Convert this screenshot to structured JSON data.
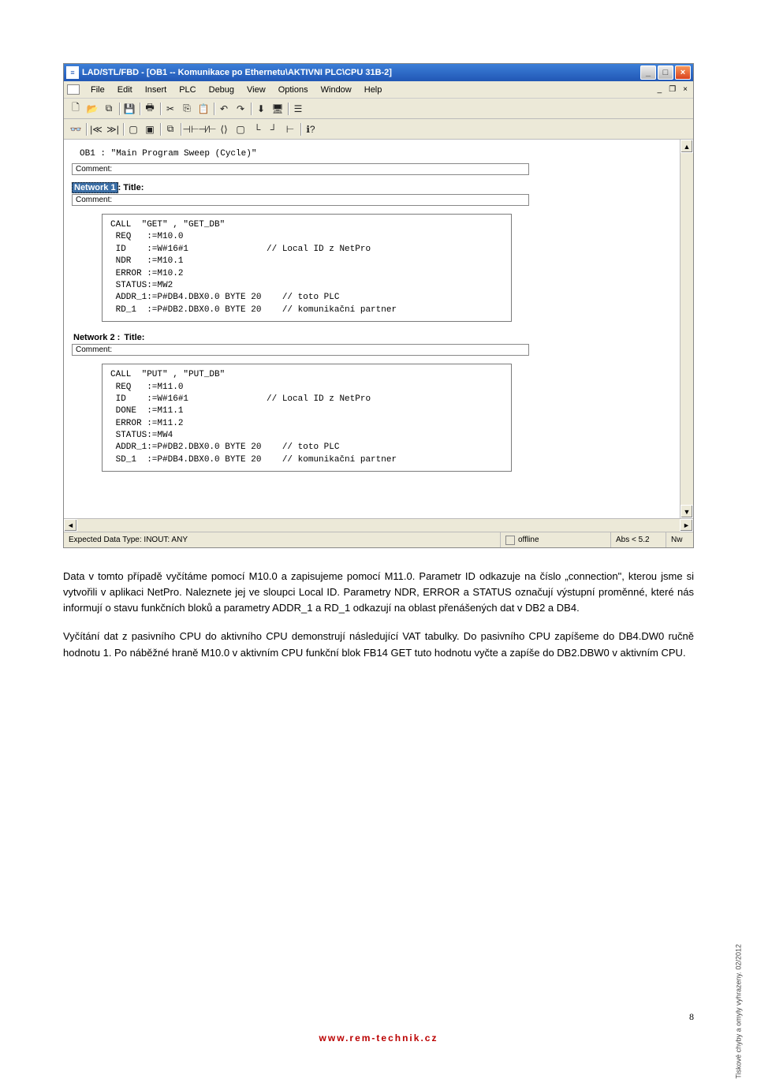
{
  "window": {
    "title": "LAD/STL/FBD  - [OB1 -- Komunikace po Ethernetu\\AKTIVNI PLC\\CPU 31B-2]",
    "minimize": "_",
    "maximize": "□",
    "close": "×"
  },
  "menu": {
    "items": [
      "File",
      "Edit",
      "Insert",
      "PLC",
      "Debug",
      "View",
      "Options",
      "Window",
      "Help"
    ],
    "mdi_minimize": "_",
    "mdi_restore": "❐",
    "mdi_close": "×"
  },
  "editor": {
    "header": "OB1 :  \"Main Program Sweep (Cycle)\"",
    "comment_label": "Comment:",
    "network1_label": "Network 1",
    "network1_title": ": Title:",
    "network2_label": "Network 2 :",
    "network2_title": " Title:",
    "code1": "CALL  \"GET\" , \"GET_DB\"\n REQ   :=M10.0\n ID    :=W#16#1               // Local ID z NetPro\n NDR   :=M10.1\n ERROR :=M10.2\n STATUS:=MW2\n ADDR_1:=P#DB4.DBX0.0 BYTE 20    // toto PLC\n RD_1  :=P#DB2.DBX0.0 BYTE 20    // komunikační partner",
    "code2": "CALL  \"PUT\" , \"PUT_DB\"\n REQ   :=M11.0\n ID    :=W#16#1               // Local ID z NetPro\n DONE  :=M11.1\n ERROR :=M11.2\n STATUS:=MW4\n ADDR_1:=P#DB2.DBX0.0 BYTE 20    // toto PLC\n SD_1  :=P#DB4.DBX0.0 BYTE 20    // komunikační partner"
  },
  "status": {
    "expected": "Expected Data Type: INOUT: ANY",
    "offline": "offline",
    "abs": "Abs < 5.2",
    "nw": "Nw"
  },
  "body": {
    "p1": "Data v tomto případě vyčítáme pomocí M10.0 a zapisujeme pomocí M11.0. Parametr ID odkazuje na číslo „connection\", kterou jsme si vytvořili v aplikaci NetPro. Naleznete jej ve sloupci Local ID. Parametry NDR, ERROR a STATUS označují výstupní proměnné, které nás informují o stavu funkčních bloků a parametry ADDR_1 a RD_1 odkazují na oblast přenášených dat v DB2 a DB4.",
    "p2": "Vyčítání dat z pasivního CPU do aktivního CPU demonstrují následující VAT tabulky. Do pasivního CPU zapíšeme do DB4.DW0 ručně hodnotu 1. Po náběžné hraně M10.0 v aktivním CPU funkční blok FB14 GET tuto hodnotu vyčte a zapíše do DB2.DBW0 v aktivním CPU."
  },
  "footer": "www.rem-technik.cz",
  "side_note": "Tiskové chyby a omyly vyhrazeny. 02/2012",
  "page_number": "8"
}
